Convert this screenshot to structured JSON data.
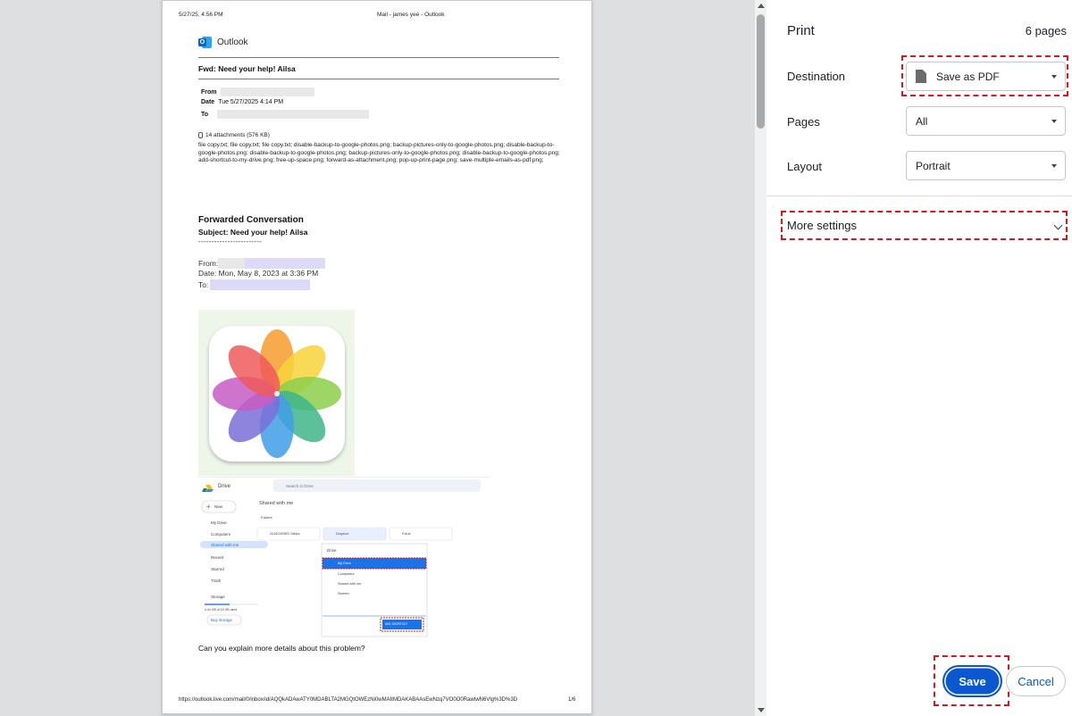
{
  "preview": {
    "header_date": "5/27/25, 4:56 PM",
    "header_title": "Mail - james yee - Outlook",
    "app_name": "Outlook",
    "subject": "Fwd: Need your help! Ailsa",
    "from_label": "From",
    "date_label": "Date",
    "date_value": "Tue 5/27/2025 4:14 PM",
    "to_label": "To",
    "attachments_count": "14 attachments (576 KB)",
    "attachments_list": "file copy.txt; file copy.txt; file copy.txt; disable-backup-to-google-photos.png; backup-pictures-only-to-google-photos.png; disable-backup-to-google-photos.png; disable-backup-to-google-photos.png; backup-pictures-only-to-google-photos.png; disable-backup-to-google-photos.png; add-shortcut-to-my-drive.png; free-up-space.png; forward-as-attachment.png; pop-up-print-page.png; save-multiple-emails-as-pdf.png;",
    "fwd_title": "Forwarded Conversation",
    "fwd_subject": "Subject: Need your help! Ailsa",
    "dashes": "------------------------",
    "fwd_from": "From:",
    "fwd_date": "Date: Mon, May 8, 2023 at 3:36 PM",
    "fwd_to": "To:",
    "question": "Can you explain more details about this problem?",
    "footer_url": "https://outlook.live.com/mail/0/inbox/id/AQQkADAwATY0MDABLTA2MGQtOWEzNi0wMAItMDAKABAAsEwNzq7VO0O0RawtwN6Vlg%3D%3D",
    "footer_page": "1/6",
    "drive": {
      "app": "Drive",
      "search": "Search in Drive",
      "new": "New",
      "nav": [
        "My Drive",
        "Computers",
        "Shared with me",
        "Recent",
        "Starred",
        "Trash",
        "Storage"
      ],
      "storage_text": "4.44 GB of 15 GB used",
      "buy_storage": "Buy storage",
      "section": "Shared with me",
      "folders_label": "Folders",
      "folders": [
        "2016CMSED Slides",
        "Dropbox",
        "Fotos"
      ],
      "popup_title": "Drive",
      "popup_items": [
        "My Drive",
        "Computers",
        "Shared with me",
        "Starred"
      ],
      "popup_button": "ADD SHORTCUT"
    }
  },
  "panel": {
    "title": "Print",
    "page_count": "6 pages",
    "destination_label": "Destination",
    "destination_value": "Save as PDF",
    "pages_label": "Pages",
    "pages_value": "All",
    "layout_label": "Layout",
    "layout_value": "Portrait",
    "more_settings": "More settings",
    "save_label": "Save",
    "cancel_label": "Cancel"
  },
  "colors": {
    "accent": "#0b57d0",
    "highlight": "#e0141c"
  }
}
